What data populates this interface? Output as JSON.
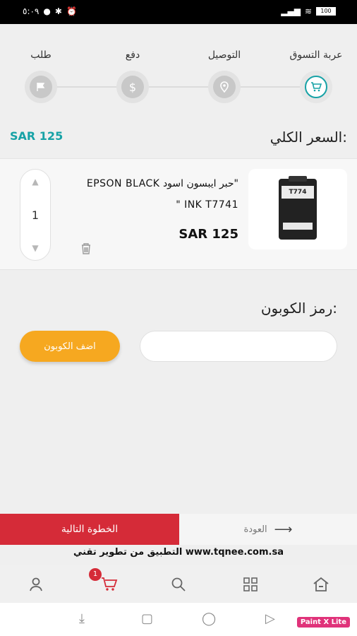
{
  "status_bar": {
    "time": "٥:٠٩",
    "battery": "100"
  },
  "steps": [
    {
      "label": "عربة التسوق",
      "icon": "cart-icon"
    },
    {
      "label": "التوصيل",
      "icon": "location-pin-icon"
    },
    {
      "label": "دفع",
      "icon": "dollar-icon"
    },
    {
      "label": "طلب",
      "icon": "flag-icon"
    }
  ],
  "total": {
    "label": "السعر الكلي:",
    "amount": "SAR 125"
  },
  "cart_item": {
    "title": "\"حبر ايبسون اسود EPSON BLACK INK T7741 \"",
    "price": "SAR 125",
    "quantity": "1",
    "product_label": "T774"
  },
  "coupon": {
    "label": "رمز الكوبون:",
    "input_value": "",
    "button_label": "اضف الكوبون"
  },
  "footer_actions": {
    "next_label": "الخطوة التالية",
    "back_label": "العودة"
  },
  "credit_text": "التطبيق من تطوير تقني  www.tqnee.com.sa",
  "bottom_nav": {
    "cart_badge": "1"
  },
  "watermark": "Paint X Lite",
  "colors": {
    "accent": "#17a2a6",
    "primary": "#d52b38",
    "coupon": "#f6a820"
  }
}
